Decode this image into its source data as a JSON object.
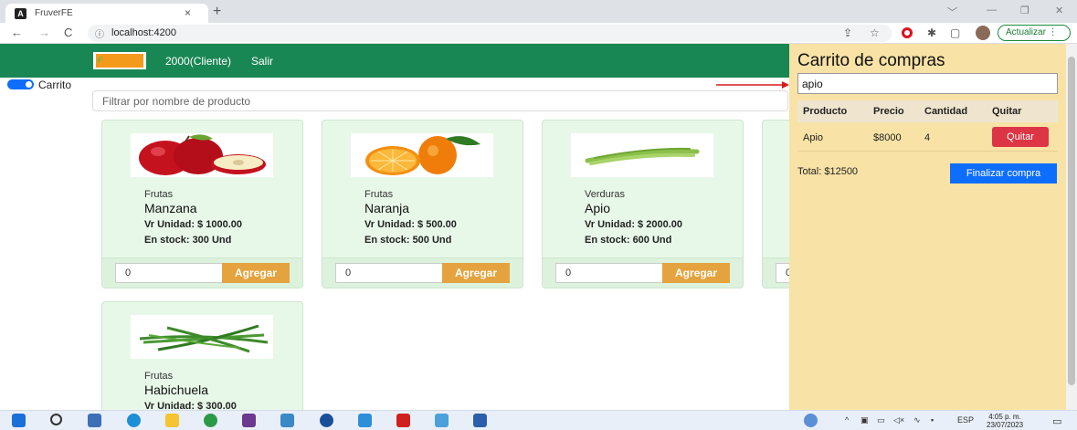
{
  "browser": {
    "tab_title": "FruverFE",
    "tab_close": "×",
    "new_tab": "+",
    "url": "localhost:4200",
    "update_label": "Actualizar"
  },
  "nav": {
    "user": "2000(Cliente)",
    "logout": "Salir"
  },
  "toggle": {
    "label": "Carrito",
    "on": true
  },
  "filter": {
    "placeholder": "Filtrar por nombre de producto"
  },
  "products": [
    {
      "category": "Frutas",
      "name": "Manzana",
      "price": "Vr Unidad: $ 1000.00",
      "stock": "En stock: 300 Und",
      "qty": "0",
      "add_label": "Agregar"
    },
    {
      "category": "Frutas",
      "name": "Naranja",
      "price": "Vr Unidad: $ 500.00",
      "stock": "En stock: 500 Und",
      "qty": "0",
      "add_label": "Agregar"
    },
    {
      "category": "Verduras",
      "name": "Apio",
      "price": "Vr Unidad: $ 2000.00",
      "stock": "En stock: 600 Und",
      "qty": "0",
      "add_label": "Agregar"
    },
    {
      "qty": "0"
    },
    {
      "category": "Frutas",
      "name": "Habichuela",
      "price": "Vr Unidad: $ 300.00"
    }
  ],
  "cart": {
    "title": "Carrito de compras",
    "search_value": "apio",
    "headers": [
      "Producto",
      "Precio",
      "Cantidad",
      "Quitar"
    ],
    "rows": [
      {
        "product": "Apio",
        "price": "$8000",
        "qty": "4",
        "remove_label": "Quitar"
      }
    ],
    "total": "Total: $12500",
    "checkout_label": "Finalizar compra"
  },
  "taskbar": {
    "lang": "ESP",
    "time": "4:05 p. m.",
    "date": "23/07/2023"
  },
  "colors": {
    "nav_green": "#198754",
    "cart_bg": "#f8e2a6",
    "card_bg": "#e8f8e8",
    "add_button": "#e4a33e",
    "remove_button": "#dc3545",
    "checkout_button": "#0d6efd"
  }
}
